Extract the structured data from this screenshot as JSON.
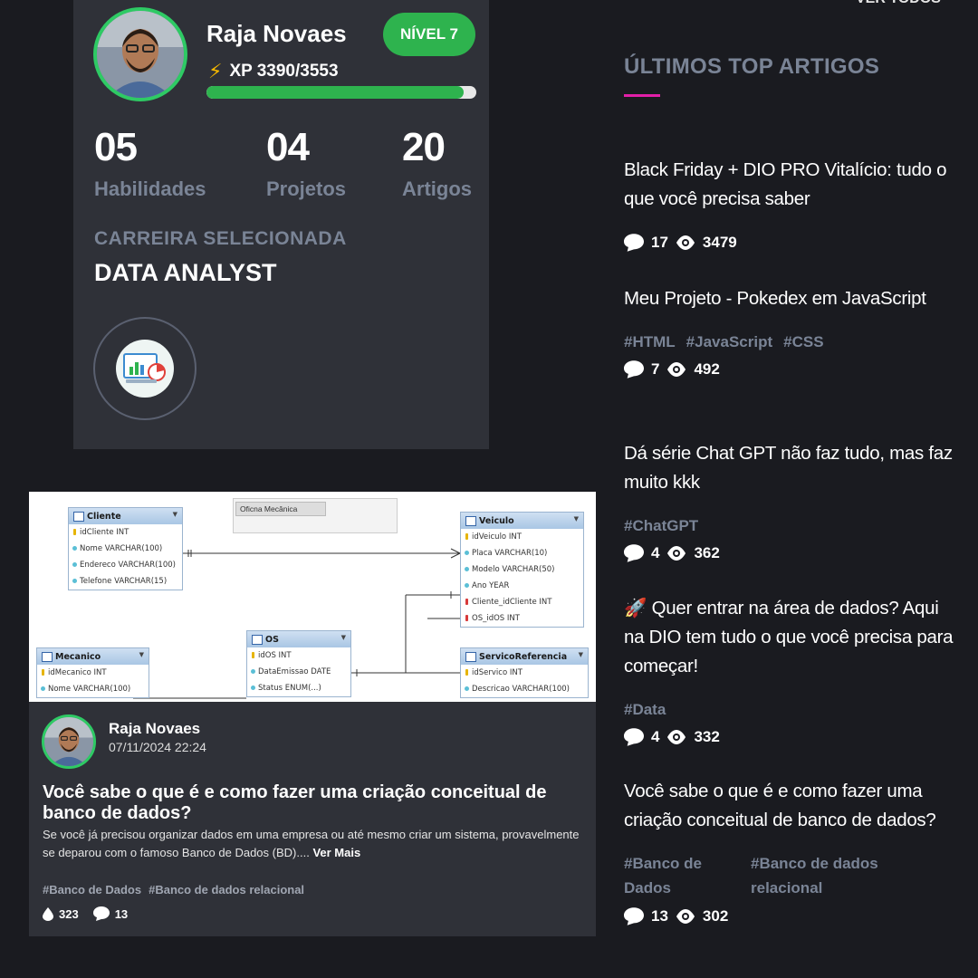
{
  "profile": {
    "name": "Raja Novaes",
    "level": "NÍVEL 7",
    "xp": "XP 3390/3553",
    "xp_progress": 0.954,
    "stats": [
      {
        "value": "05",
        "label": "Habilidades"
      },
      {
        "value": "04",
        "label": "Projetos"
      },
      {
        "value": "20",
        "label": "Artigos"
      }
    ],
    "career_label": "CARREIRA SELECIONADA",
    "career_value": "DATA ANALYST"
  },
  "colors": {
    "accent_green": "#2eb34e",
    "accent_pink": "#e21fa8",
    "card_bg": "#2f3138",
    "page_bg": "#1a1b20"
  },
  "article": {
    "diagram": {
      "note": "Oficna Mecânica",
      "tables": [
        {
          "name": "Cliente",
          "rows": [
            "idCliente INT",
            "Nome VARCHAR(100)",
            "Endereco VARCHAR(100)",
            "Telefone VARCHAR(15)"
          ]
        },
        {
          "name": "Veiculo",
          "rows": [
            "idVeiculo INT",
            "Placa VARCHAR(10)",
            "Modelo VARCHAR(50)",
            "Ano YEAR",
            "Cliente_idCliente INT",
            "OS_idOS INT"
          ]
        },
        {
          "name": "Mecanico",
          "rows": [
            "idMecanico INT",
            "Nome VARCHAR(100)"
          ]
        },
        {
          "name": "OS",
          "rows": [
            "idOS INT",
            "DataEmissao DATE",
            "Status ENUM(...)"
          ]
        },
        {
          "name": "ServicoReferencia",
          "rows": [
            "idServico INT",
            "Descricao VARCHAR(100)"
          ]
        }
      ]
    },
    "author": "Raja Novaes",
    "date": "07/11/2024 22:24",
    "title": "Você sabe o que é e como fazer uma criação conceitual de banco de dados?",
    "excerpt": "Se você já precisou organizar dados em uma empresa ou até mesmo criar um sistema, provavelmente se deparou com o famoso Banco de Dados (BD)....",
    "read_more": "Ver Mais",
    "tags": [
      "#Banco de Dados",
      "#Banco de dados relacional"
    ],
    "likes": "323",
    "comments": "13"
  },
  "sidebar": {
    "see_all": "VER TODOS",
    "title": "ÚLTIMOS TOP ARTIGOS",
    "articles": [
      {
        "title": "Black Friday + DIO PRO Vitalício: tudo o que você precisa saber",
        "tags": [],
        "comments": "17",
        "views": "3479"
      },
      {
        "title": "Meu Projeto - Pokedex em JavaScript",
        "tags": [
          "#HTML",
          "#JavaScript",
          "#CSS"
        ],
        "comments": "7",
        "views": "492"
      },
      {
        "title": "Dá série Chat GPT não faz tudo, mas faz muito kkk",
        "tags": [
          "#ChatGPT"
        ],
        "comments": "4",
        "views": "362"
      },
      {
        "title": "🚀 Quer entrar na área de dados? Aqui na DIO tem tudo o que você precisa para começar!",
        "tags": [
          "#Data"
        ],
        "comments": "4",
        "views": "332"
      },
      {
        "title": "Você sabe o que é e como fazer uma criação conceitual de banco de dados?",
        "tags": [
          "#Banco de Dados",
          "#Banco de dados relacional"
        ],
        "comments": "13",
        "views": "302"
      }
    ]
  }
}
